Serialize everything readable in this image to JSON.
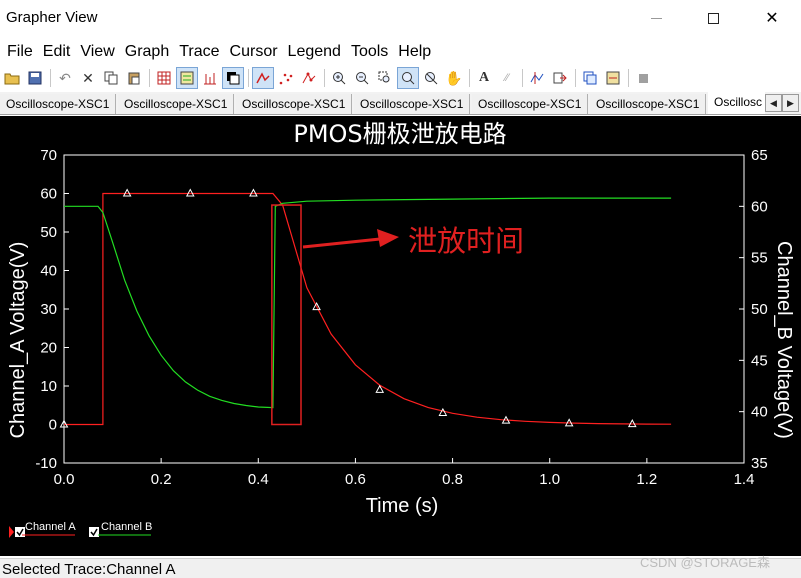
{
  "window": {
    "title": "Grapher View"
  },
  "menu": [
    "File",
    "Edit",
    "View",
    "Graph",
    "Trace",
    "Cursor",
    "Legend",
    "Tools",
    "Help"
  ],
  "toolbar_icons": [
    "open-icon",
    "save-icon",
    "undo-icon",
    "cut-icon",
    "copy-icon",
    "paste-icon",
    "grid-icon",
    "legend-icon",
    "ticks-icon",
    "invert-colors-icon",
    "line-trace-icon",
    "dot-trace-icon",
    "marker-trace-icon",
    "zoom-in-icon",
    "zoom-out-icon",
    "zoom-area-icon",
    "zoom-x-icon",
    "zoom-y-icon",
    "pan-icon",
    "text-icon",
    "label-icon",
    "cursors-icon",
    "export-icon",
    "overlay-icon",
    "merge-icon",
    "stop-icon"
  ],
  "tabs": [
    "Oscilloscope-XSC1",
    "Oscilloscope-XSC1",
    "Oscilloscope-XSC1",
    "Oscilloscope-XSC1",
    "Oscilloscope-XSC1",
    "Oscilloscope-XSC1",
    "Oscillosc"
  ],
  "colors": {
    "background": "#000000",
    "axes": "#ffffff",
    "channel_a": "#ff2020",
    "channel_b": "#22dd22",
    "annotation": "#e02020"
  },
  "chart_data": {
    "type": "line",
    "title": "PMOS栅极泄放电路",
    "xlabel": "Time (s)",
    "ylabel": "Channel_A Voltage(V)",
    "y2label": "Channel_B Voltage(V)",
    "xlim": [
      0,
      1.4
    ],
    "ylim": [
      -10,
      70
    ],
    "y2lim": [
      35,
      65
    ],
    "xticks": [
      "0.0",
      "0.2",
      "0.4",
      "0.6",
      "0.8",
      "1.0",
      "1.2",
      "1.4"
    ],
    "yticks": [
      "-10",
      "0",
      "10",
      "20",
      "30",
      "40",
      "50",
      "60",
      "70"
    ],
    "y2ticks": [
      "35",
      "40",
      "45",
      "50",
      "55",
      "60",
      "65"
    ],
    "legend_position": "bottom-left",
    "series": [
      {
        "name": "Channel A",
        "axis": "left",
        "x": [
          0.0,
          0.08,
          0.08,
          0.43,
          0.45,
          0.5,
          0.55,
          0.6,
          0.65,
          0.7,
          0.75,
          0.8,
          0.85,
          0.9,
          0.95,
          1.0,
          1.05,
          1.1,
          1.15,
          1.2,
          1.25
        ],
        "y": [
          0,
          0,
          60,
          60,
          57,
          35.5,
          23.5,
          15.5,
          10.2,
          6.7,
          4.4,
          2.9,
          1.9,
          1.25,
          0.82,
          0.54,
          0.36,
          0.24,
          0.15,
          0.1,
          0.07
        ],
        "marker_x": [
          0.0,
          0.13,
          0.26,
          0.39,
          0.52,
          0.65,
          0.78,
          0.91,
          1.04,
          1.17
        ],
        "marker_y": [
          0,
          60,
          60,
          60,
          30.5,
          9,
          3,
          1,
          0.3,
          0.1
        ]
      },
      {
        "name": "Channel B",
        "axis": "right",
        "x": [
          0.0,
          0.07,
          0.08,
          0.1,
          0.125,
          0.15,
          0.175,
          0.2,
          0.225,
          0.25,
          0.275,
          0.3,
          0.325,
          0.35,
          0.375,
          0.4,
          0.43,
          0.435,
          0.45,
          0.5,
          0.6,
          0.8,
          1.0,
          1.25
        ],
        "y": [
          60,
          60,
          59.4,
          56.5,
          52.8,
          49.8,
          47.4,
          45.5,
          44.0,
          42.9,
          42.1,
          41.5,
          41.1,
          40.8,
          40.6,
          40.45,
          40.4,
          60,
          60.3,
          60.5,
          60.6,
          60.7,
          60.8,
          60.8
        ]
      }
    ],
    "annotation": {
      "text": "泄放时间",
      "box_x": [
        0.43,
        0.49
      ],
      "box_y": [
        0,
        57
      ]
    }
  },
  "legend": [
    {
      "label": "Channel A",
      "checked": true
    },
    {
      "label": "Channel B",
      "checked": true
    }
  ],
  "status": {
    "text": "Selected Trace:Channel A",
    "watermark": "CSDN @STORAGE森"
  }
}
